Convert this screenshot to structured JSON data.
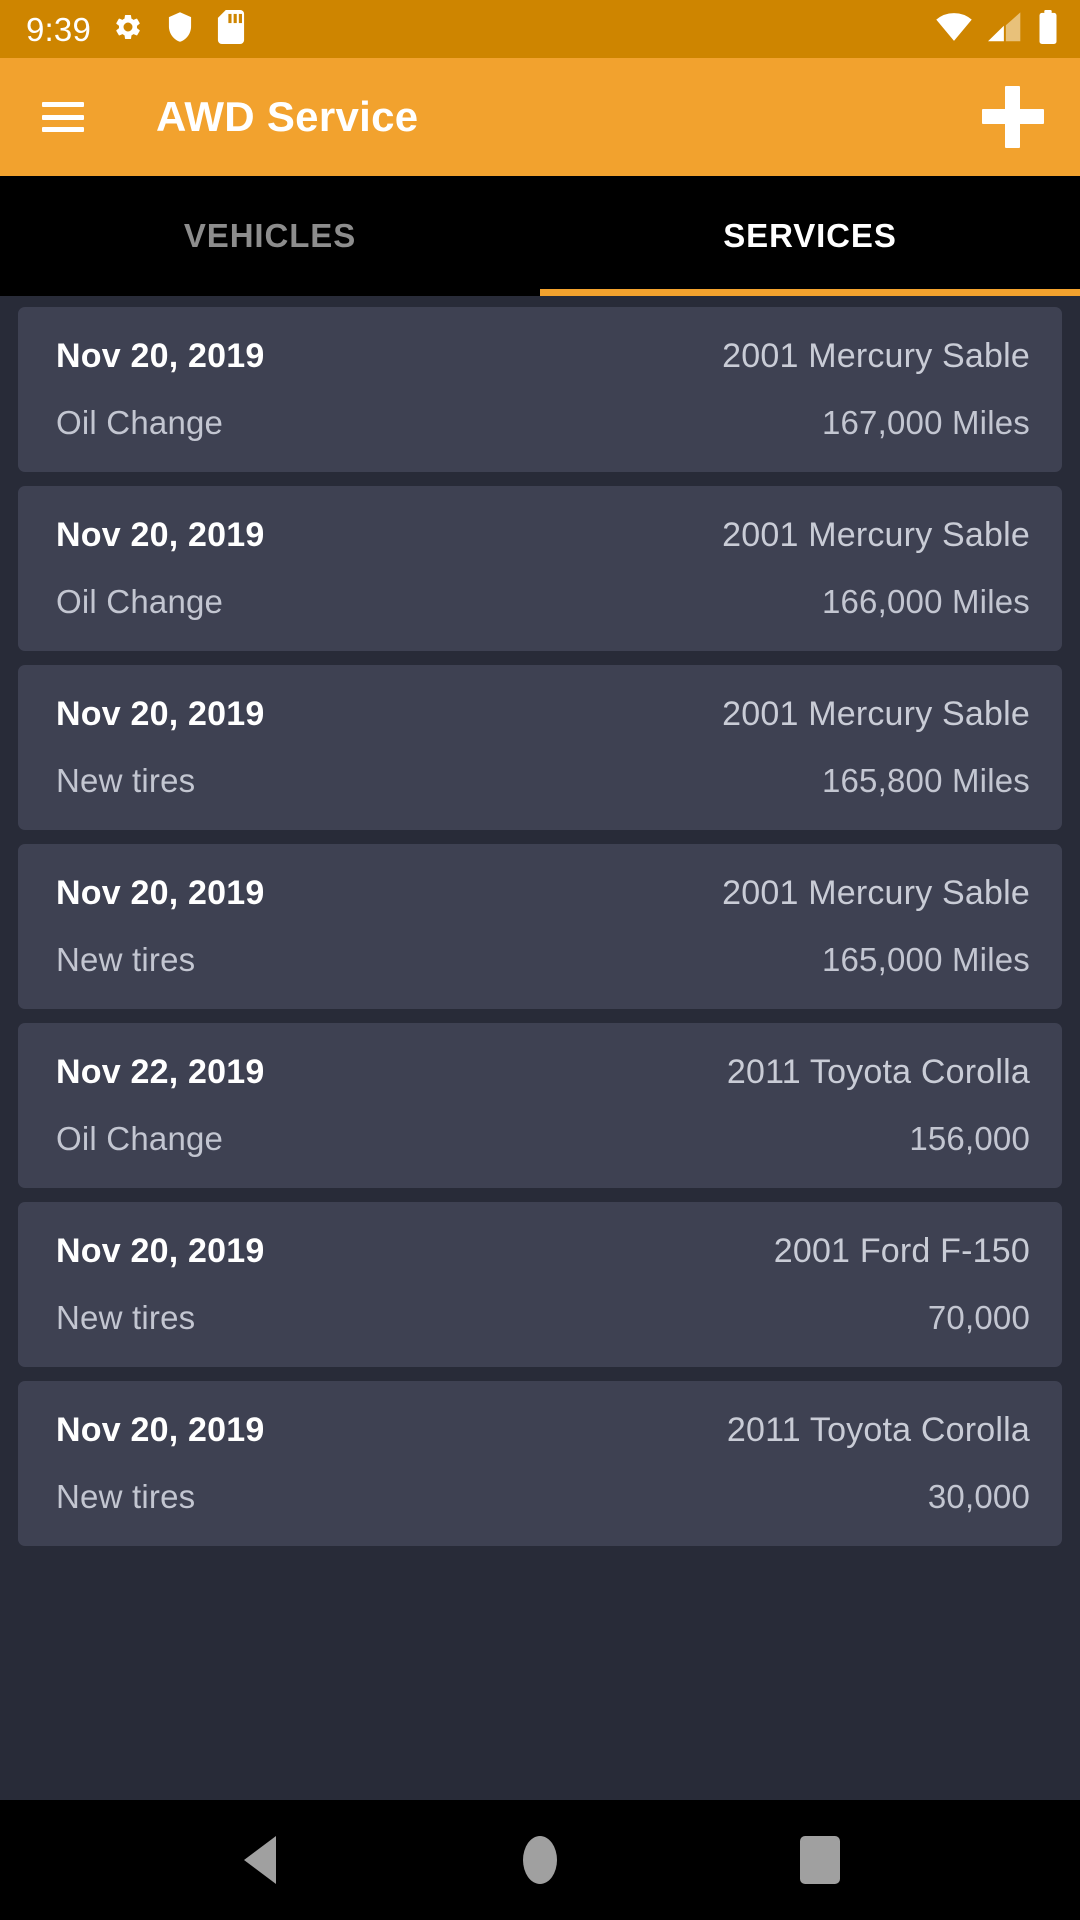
{
  "status_bar": {
    "time": "9:39",
    "left_icons": [
      "gear-icon",
      "shield-icon",
      "sd-card-icon"
    ],
    "right_icons": [
      "wifi-icon",
      "cellular-signal-icon",
      "battery-icon"
    ],
    "background_color": "#CE8500"
  },
  "app_bar": {
    "menu_icon": "hamburger-menu-icon",
    "title": "AWD Service",
    "add_icon": "plus-icon",
    "background_color": "#F2A22E"
  },
  "tabs": [
    {
      "label": "VEHICLES",
      "active": false
    },
    {
      "label": "SERVICES",
      "active": true
    }
  ],
  "tab_indicator_color": "#F2A22E",
  "services": [
    {
      "date": "Nov 20, 2019",
      "vehicle": "2001 Mercury Sable",
      "service": "Oil Change",
      "mileage": "167,000 Miles"
    },
    {
      "date": "Nov 20, 2019",
      "vehicle": "2001 Mercury Sable",
      "service": "Oil Change",
      "mileage": "166,000 Miles"
    },
    {
      "date": "Nov 20, 2019",
      "vehicle": "2001 Mercury Sable",
      "service": "New tires",
      "mileage": "165,800 Miles"
    },
    {
      "date": "Nov 20, 2019",
      "vehicle": "2001 Mercury Sable",
      "service": "New tires",
      "mileage": "165,000 Miles"
    },
    {
      "date": "Nov 22, 2019",
      "vehicle": "2011 Toyota Corolla",
      "service": "Oil Change",
      "mileage": "156,000"
    },
    {
      "date": "Nov 20, 2019",
      "vehicle": "2001 Ford F-150",
      "service": "New tires",
      "mileage": "70,000"
    },
    {
      "date": "Nov 20, 2019",
      "vehicle": "2011 Toyota Corolla",
      "service": "New tires",
      "mileage": "30,000"
    }
  ],
  "nav_bar": {
    "back_icon": "back-triangle-icon",
    "home_icon": "home-circle-icon",
    "recents_icon": "recents-square-icon"
  },
  "colors": {
    "page_background": "#282B38",
    "card_background": "#3E4152",
    "accent": "#F2A22E",
    "primary_text": "#FFFFFF",
    "secondary_text": "#C3C6D1"
  }
}
